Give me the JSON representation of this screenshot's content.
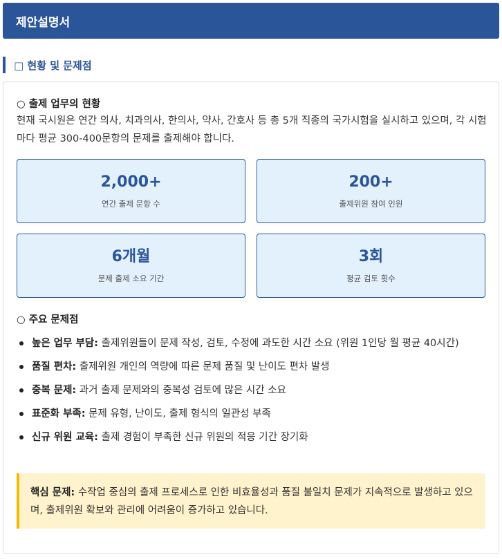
{
  "header": {
    "title": "제안설명서"
  },
  "section": {
    "title": "□ 현황 및 문제점"
  },
  "current": {
    "heading": "○ 출제 업무의 현황",
    "description": "현재 국시원은 연간 의사, 치과의사, 한의사, 약사, 간호사 등 총 5개 직종의 국가시험을 실시하고 있으며, 각 시험마다 평균 300-400문항의 문제를 출제해야 합니다."
  },
  "stats": [
    {
      "value": "2,000+",
      "label": "연간 출제 문항 수"
    },
    {
      "value": "200+",
      "label": "출제위원 참여 인원"
    },
    {
      "value": "6개월",
      "label": "문제 출제 소요 기간"
    },
    {
      "value": "3회",
      "label": "평균 검토 횟수"
    }
  ],
  "problems": {
    "heading": "○ 주요 문제점",
    "items": [
      {
        "term": "높은 업무 부담:",
        "text": " 출제위원들이 문제 작성, 검토, 수정에 과도한 시간 소요 (위원 1인당 월 평균 40시간)"
      },
      {
        "term": "품질 편차:",
        "text": " 출제위원 개인의 역량에 따른 문제 품질 및 난이도 편차 발생"
      },
      {
        "term": "중복 문제:",
        "text": " 과거 출제 문제와의 중복성 검토에 많은 시간 소요"
      },
      {
        "term": "표준화 부족:",
        "text": " 문제 유형, 난이도, 출제 형식의 일관성 부족"
      },
      {
        "term": "신규 위원 교육:",
        "text": " 출제 경험이 부족한 신규 위원의 적응 기간 장기화"
      }
    ]
  },
  "callout": {
    "term": "핵심 문제:",
    "text": " 수작업 중심의 출제 프로세스로 인한 비효율성과 품질 불일치 문제가 지속적으로 발생하고 있으며, 출제위원 확보와 관리에 어려움이 증가하고 있습니다."
  },
  "colors": {
    "primary": "#2a5599",
    "stat_bg": "#e3f1fd",
    "callout_bg": "#fff3cd",
    "callout_border": "#f5b900"
  }
}
